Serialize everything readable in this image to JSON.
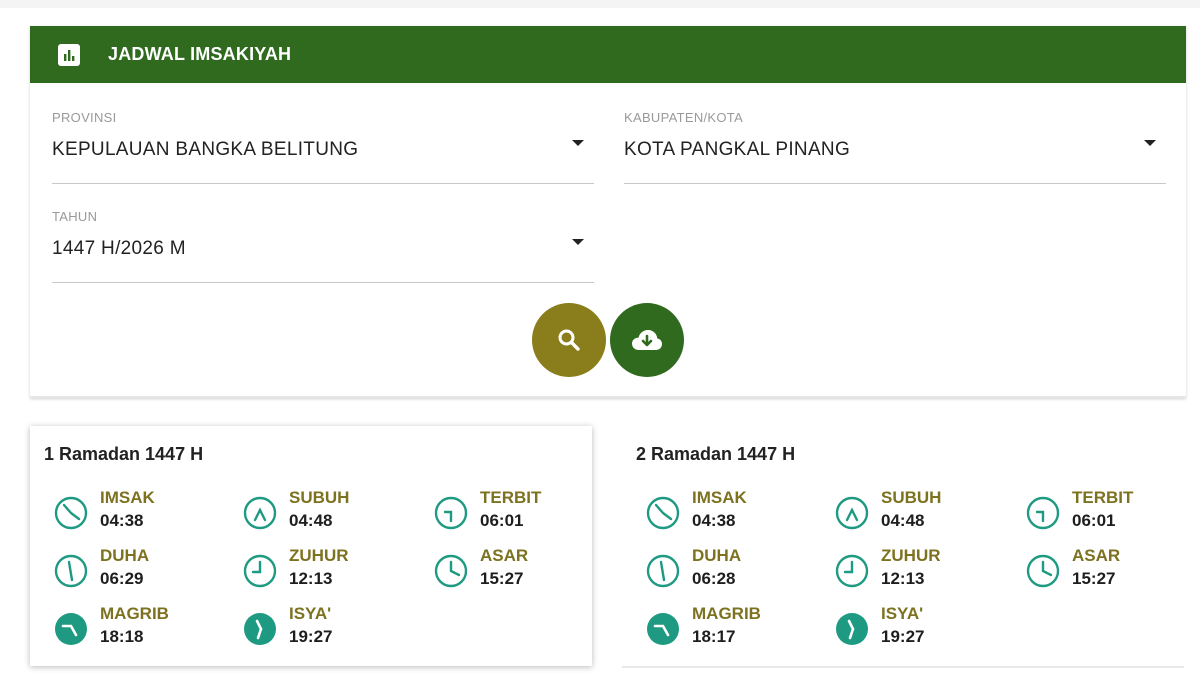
{
  "header": {
    "title": "JADWAL IMSAKIYAH",
    "icon": "bar-chart-icon"
  },
  "form": {
    "provinsi": {
      "label": "PROVINSI",
      "value": "KEPULAUAN BANGKA BELITUNG"
    },
    "kota": {
      "label": "KABUPATEN/KOTA",
      "value": "KOTA PANGKAL PINANG"
    },
    "tahun": {
      "label": "TAHUN",
      "value": "1447 H/2026 M"
    }
  },
  "buttons": {
    "search": {
      "icon": "search-icon",
      "color": "#8a7d1c"
    },
    "download": {
      "icon": "cloud-download-icon",
      "color": "#2f6a1f"
    }
  },
  "colors": {
    "brand_green": "#2f6a1f",
    "accent_olive": "#7c7220",
    "teal": "#1f9a82"
  },
  "days": [
    {
      "title": "1 Ramadan 1447 H",
      "prayers": [
        {
          "name": "IMSAK",
          "time": "04:38"
        },
        {
          "name": "SUBUH",
          "time": "04:48"
        },
        {
          "name": "TERBIT",
          "time": "06:01"
        },
        {
          "name": "DUHA",
          "time": "06:29"
        },
        {
          "name": "ZUHUR",
          "time": "12:13"
        },
        {
          "name": "ASAR",
          "time": "15:27"
        },
        {
          "name": "MAGRIB",
          "time": "18:18"
        },
        {
          "name": "ISYA'",
          "time": "19:27"
        }
      ]
    },
    {
      "title": "2 Ramadan 1447 H",
      "prayers": [
        {
          "name": "IMSAK",
          "time": "04:38"
        },
        {
          "name": "SUBUH",
          "time": "04:48"
        },
        {
          "name": "TERBIT",
          "time": "06:01"
        },
        {
          "name": "DUHA",
          "time": "06:28"
        },
        {
          "name": "ZUHUR",
          "time": "12:13"
        },
        {
          "name": "ASAR",
          "time": "15:27"
        },
        {
          "name": "MAGRIB",
          "time": "18:17"
        },
        {
          "name": "ISYA'",
          "time": "19:27"
        }
      ]
    }
  ]
}
